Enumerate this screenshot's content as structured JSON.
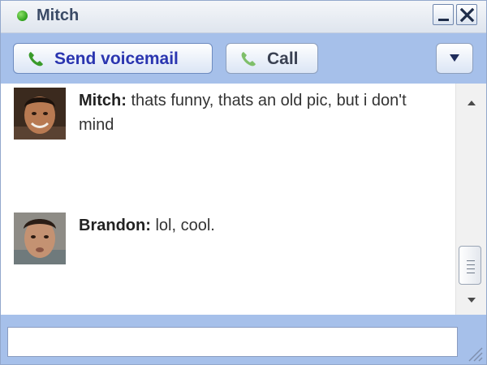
{
  "window": {
    "title": "Mitch",
    "status": "online",
    "status_color": "#2ea11a",
    "buttons": [
      "minimize-icon",
      "close-icon"
    ]
  },
  "toolbar": {
    "voicemail_label": "Send voicemail",
    "call_label": "Call",
    "dropdown_icon": "triangle-down-icon"
  },
  "messages": [
    {
      "sender": "Mitch:",
      "text": " thats funny, thats an old pic, but i don't mind"
    },
    {
      "sender": "Brandon:",
      "text": " lol, cool."
    }
  ],
  "input": {
    "value": "",
    "placeholder": ""
  },
  "colors": {
    "toolbar_bg": "#a6c0ea",
    "accent_text": "#2a35b0",
    "phone_green": "#3a9b2a"
  }
}
